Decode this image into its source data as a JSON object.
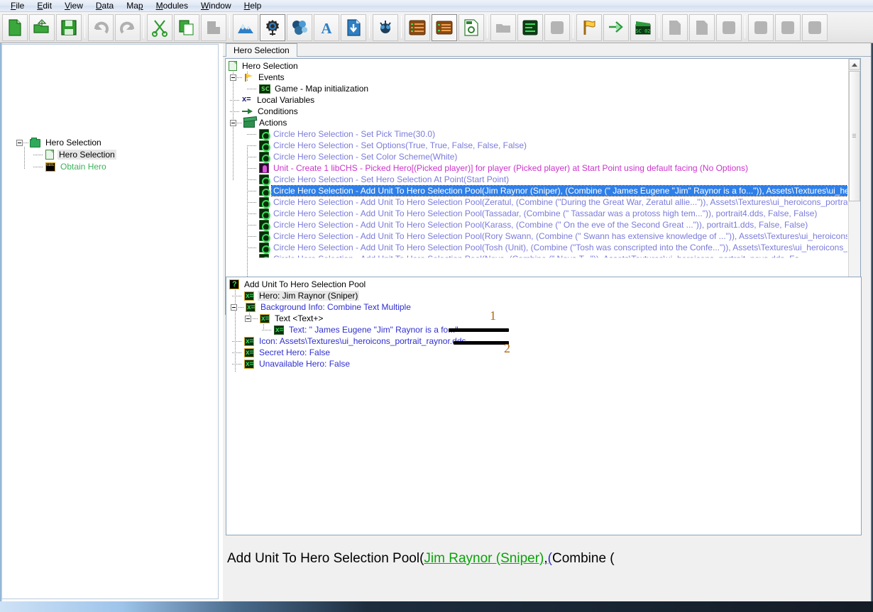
{
  "menu": {
    "items": [
      {
        "label": "File",
        "accel": "F"
      },
      {
        "label": "Edit",
        "accel": "E"
      },
      {
        "label": "View",
        "accel": "V"
      },
      {
        "label": "Data",
        "accel": "D"
      },
      {
        "label": "Map",
        "accel": "p"
      },
      {
        "label": "Modules",
        "accel": "M"
      },
      {
        "label": "Window",
        "accel": "W"
      },
      {
        "label": "Help",
        "accel": "H"
      }
    ]
  },
  "toolbar": {
    "buttons": [
      {
        "name": "new-document-icon",
        "tooltip": "New"
      },
      {
        "name": "open-folder-icon",
        "tooltip": "Open"
      },
      {
        "name": "save-disk-icon",
        "tooltip": "Save"
      },
      {
        "name": "undo-arrow-icon",
        "tooltip": "Undo"
      },
      {
        "name": "redo-arrow-icon",
        "tooltip": "Redo"
      },
      {
        "name": "scissors-cut-icon",
        "tooltip": "Cut"
      },
      {
        "name": "copy-pages-icon",
        "tooltip": "Copy"
      },
      {
        "name": "paste-clipboard-icon",
        "tooltip": "Paste"
      },
      {
        "name": "terrain-mountains-icon",
        "tooltip": "Terrain Module"
      },
      {
        "name": "trigger-gear-icon",
        "tooltip": "Trigger Module"
      },
      {
        "name": "data-crystal-icon",
        "tooltip": "Data Module"
      },
      {
        "name": "text-a-icon",
        "tooltip": "Text Module"
      },
      {
        "name": "import-download-icon",
        "tooltip": "Import Module"
      },
      {
        "name": "ai-zerg-icon",
        "tooltip": "AI Module"
      },
      {
        "name": "list-orange-icon",
        "tooltip": "Object List"
      },
      {
        "name": "table-orange-icon",
        "tooltip": "Data Table"
      },
      {
        "name": "settings-page-icon",
        "tooltip": "Settings"
      },
      {
        "name": "folder-gray-icon",
        "tooltip": "Folder"
      },
      {
        "name": "script-green-icon",
        "tooltip": "Script"
      },
      {
        "name": "blank-gray-icon",
        "tooltip": "Blank"
      },
      {
        "name": "flag-yellow-icon",
        "tooltip": "New Event"
      },
      {
        "name": "arrow-green-icon",
        "tooltip": "New Condition"
      },
      {
        "name": "clapboard-green-icon",
        "tooltip": "New Action"
      },
      {
        "name": "page-gray-1-icon",
        "tooltip": "Disabled"
      },
      {
        "name": "page-gray-2-icon",
        "tooltip": "Disabled"
      },
      {
        "name": "square-gray-1-icon",
        "tooltip": "Disabled"
      },
      {
        "name": "square-gray-2-icon",
        "tooltip": "Disabled"
      },
      {
        "name": "square-gray-3-icon",
        "tooltip": "Disabled"
      },
      {
        "name": "square-gray-4-icon",
        "tooltip": "Disabled"
      }
    ]
  },
  "sidebar": {
    "root": {
      "label": "Hero Selection",
      "icon": "folder-icon"
    },
    "children": [
      {
        "label": "Hero Selection",
        "icon": "trigger-doc-icon",
        "selected": true
      },
      {
        "label": "Obtain Hero",
        "icon": "custom-script-icon",
        "selected": false
      }
    ]
  },
  "mdi": {
    "tab": {
      "label": "Hero Selection"
    }
  },
  "trigger_tree": {
    "title": "Hero Selection",
    "sections": [
      {
        "label": "Events",
        "icon": "flag-icon"
      },
      {
        "label": "Local Variables",
        "icon": "xeq-icon"
      },
      {
        "label": "Conditions",
        "icon": "arrow-icon"
      },
      {
        "label": "Actions",
        "icon": "clapboard-icon"
      }
    ],
    "events": [
      {
        "label": "Game - Map initialization",
        "icon": "sc-icon"
      }
    ],
    "actions": [
      {
        "text": "Circle Hero Selection - Set Pick Time(30.0)",
        "color": "blue",
        "icon": "gear-icon",
        "selected": false
      },
      {
        "text": "Circle Hero Selection - Set Options(True, True, False, False, False)",
        "color": "blue",
        "icon": "gear-icon",
        "selected": false
      },
      {
        "text": "Circle Hero Selection - Set Color Scheme(White)",
        "color": "blue",
        "icon": "gear-icon",
        "selected": false
      },
      {
        "text": "Unit - Create 1 libCHS - Picked Hero[(Picked player)] for player (Picked player) at Start Point using default facing (No Options)",
        "color": "magenta",
        "icon": "unit-icon",
        "selected": false
      },
      {
        "text": "Circle Hero Selection - Set Hero Selection At Point(Start Point)",
        "color": "blue",
        "icon": "gear-icon",
        "selected": false
      },
      {
        "text": "Circle Hero Selection - Add Unit To Hero Selection Pool(Jim Raynor (Sniper), (Combine (\"  James Eugene \"Jim\" Raynor is a fo...\")), Assets\\Textures\\ui_heroicons_portrait_rayn",
        "color": "blue",
        "icon": "gear-icon",
        "selected": true
      },
      {
        "text": "Circle Hero Selection - Add Unit To Hero Selection Pool(Zeratul, (Combine (\"During the Great War, Zeratul allie...\")), Assets\\Textures\\ui_heroicons_portrait_zeratul.dds, False,",
        "color": "blue",
        "icon": "gear-icon",
        "selected": false
      },
      {
        "text": "Circle Hero Selection - Add Unit To Hero Selection Pool(Tassadar, (Combine (\"    Tassadar was a protoss high tem...\")), portrait4.dds, False, False)",
        "color": "blue",
        "icon": "gear-icon",
        "selected": false
      },
      {
        "text": "Circle Hero Selection - Add Unit To Hero Selection Pool(Karass, (Combine (\"    On the eve of the Second Great ...\")), portrait1.dds, False, False)",
        "color": "blue",
        "icon": "gear-icon",
        "selected": false
      },
      {
        "text": "Circle Hero Selection - Add Unit To Hero Selection Pool(Rory Swann, (Combine (\"  Swann has extensive knowledge of ...\")), Assets\\Textures\\ui_heroicons_portrait_swann.dd",
        "color": "blue",
        "icon": "gear-icon",
        "selected": false
      },
      {
        "text": "Circle Hero Selection - Add Unit To Hero Selection Pool(Tosh (Unit), (Combine (\"Tosh was conscripted into the Confe...\")), Assets\\Textures\\ui_heroicons_portrait_tosh.dds, Fa",
        "color": "blue",
        "icon": "gear-icon",
        "selected": false
      },
      {
        "text": "Circle Hero Selection - Add Unit To Hero Selection Pool(Nova, (Combine (\"  Nova  T...\")), Assets\\Textures\\ui_heroicons_portrait_nova.dds, Fa",
        "color": "blue",
        "icon": "gear-icon",
        "selected": false
      }
    ]
  },
  "param_tree": {
    "root": {
      "label": "Add Unit To Hero Selection Pool",
      "icon": "question-icon"
    },
    "rows": [
      {
        "label": "Hero: Jim Raynor (Sniper)",
        "color": "black",
        "highlight": true,
        "icon": "xvar-icon",
        "indent": 0,
        "expander": "none"
      },
      {
        "label": "Background Info: Combine Text Multiple",
        "color": "blue",
        "highlight": false,
        "icon": "xvar-icon",
        "indent": 0,
        "expander": "minus"
      },
      {
        "label": "Text <Text+>",
        "color": "black",
        "highlight": false,
        "icon": "xvar-icon",
        "indent": 1,
        "expander": "minus"
      },
      {
        "label": "Text: \"  James Eugene \"Jim\" Raynor is a fo...\"",
        "color": "blue",
        "highlight": false,
        "icon": "xvar-dark-icon",
        "indent": 2,
        "expander": "none"
      },
      {
        "label": "Icon: Assets\\Textures\\ui_heroicons_portrait_raynor.dds",
        "color": "blue",
        "highlight": false,
        "icon": "xvar-icon",
        "indent": 0,
        "expander": "none"
      },
      {
        "label": "Secret Hero: False",
        "color": "blue",
        "highlight": false,
        "icon": "xvar-icon",
        "indent": 0,
        "expander": "none"
      },
      {
        "label": "Unavailable Hero: False",
        "color": "blue",
        "highlight": false,
        "icon": "xvar-icon",
        "indent": 0,
        "expander": "none"
      }
    ],
    "annotations": [
      {
        "number": "1",
        "redaction": true
      },
      {
        "number": "2",
        "redaction": true
      }
    ]
  },
  "detail_bar": {
    "prefix": "Add Unit To Hero Selection Pool(",
    "param_green": "Jim Raynor (Sniper)",
    "middle": ", ",
    "paren_blue": "(",
    "suffix": "Combine ("
  },
  "colors": {
    "selection_blue": "#2f7fe8",
    "action_blue": "#7b7bdb",
    "unit_magenta": "#cc33cc",
    "param_blue": "#2f2fd0",
    "detail_green": "#0aa30a",
    "annotation_orange": "#b06a10",
    "sidebar_green": "#3bb25a"
  }
}
